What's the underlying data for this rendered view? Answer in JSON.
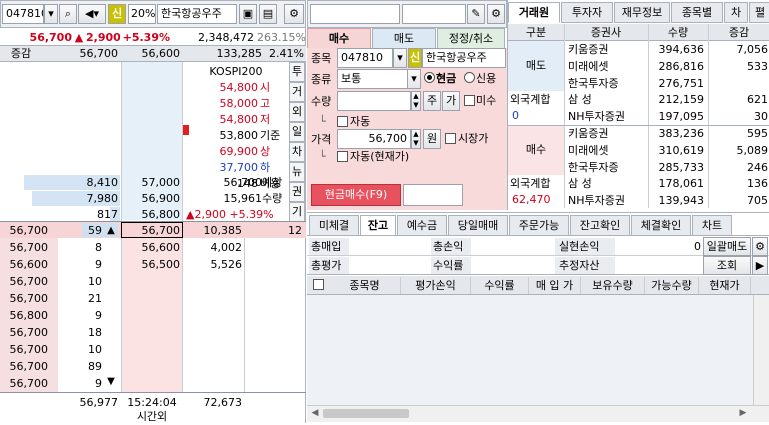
{
  "left": {
    "code": "047810",
    "sin": "신",
    "pct20": "20%",
    "name": "한국항공우주",
    "price": "56,700",
    "arrow": "▲",
    "change": "2,900",
    "rate": "+5.39%",
    "volume": "2,348,472",
    "vrate": "263.15%",
    "hdr_inc": "증감",
    "hdr_p1": "56,700",
    "hdr_p2": "56,600",
    "hdr_amt": "133,285",
    "hdr_ratio": "2.41%",
    "info": [
      {
        "v": "KOSPI200",
        "l": "",
        "c": ""
      },
      {
        "v": "54,800",
        "l": "시",
        "c": "red"
      },
      {
        "v": "58,000",
        "l": "고",
        "c": "red"
      },
      {
        "v": "54,800",
        "l": "저",
        "c": "red"
      },
      {
        "v": "53,800",
        "l": "기준",
        "c": ""
      },
      {
        "v": "69,900",
        "l": "상",
        "c": "red"
      },
      {
        "v": "37,700",
        "l": "하",
        "c": "blue"
      },
      {
        "v": "148",
        "l": "비용",
        "c": ""
      }
    ],
    "side_tabs": [
      "투",
      "거",
      "외",
      "일",
      "차",
      "뉴",
      "권",
      "기"
    ],
    "ask_rows": [
      {
        "q": "8,410",
        "p": "57,000"
      },
      {
        "q": "7,980",
        "p": "56,900"
      },
      {
        "q": "817",
        "p": "56,800"
      }
    ],
    "expect": {
      "p": "56,700",
      "l": "예상"
    },
    "qty": {
      "v": "15,961",
      "l": "수량"
    },
    "expect_chg": "▲2,900  +5.39%",
    "bid_row": {
      "t": "56,700",
      "n": "59",
      "p": "56,700",
      "q": "10,385",
      "x": "12"
    },
    "bid_rows": [
      {
        "p": "56,600",
        "q": "4,002"
      },
      {
        "p": "56,500",
        "q": "5,526"
      }
    ],
    "ticks": [
      {
        "p": "56,700",
        "n": "8"
      },
      {
        "p": "56,600",
        "n": "9"
      },
      {
        "p": "56,700",
        "n": "10"
      },
      {
        "p": "56,700",
        "n": "21"
      },
      {
        "p": "56,800",
        "n": "9"
      },
      {
        "p": "56,700",
        "n": "18"
      },
      {
        "p": "56,700",
        "n": "10"
      },
      {
        "p": "56,700",
        "n": "89"
      },
      {
        "p": "56,700",
        "n": "9"
      }
    ],
    "footer": {
      "avg": "56,977",
      "time": "15:24:04",
      "after": "시간외",
      "sum": "72,673"
    }
  },
  "order": {
    "tab_buy": "매수",
    "tab_sell": "매도",
    "tab_mod": "정정/취소",
    "lbl_item": "종목",
    "code": "047810",
    "sin": "신",
    "name": "한국항공우주",
    "lbl_type": "종류",
    "type": "보통",
    "cash": "현금",
    "credit": "신용",
    "lbl_qty": "수량",
    "qty_btn1": "주",
    "qty_btn2": "가",
    "unset": "미수",
    "auto1": "자동",
    "lbl_price": "가격",
    "price": "56,700",
    "won": "원",
    "market": "시장가",
    "auto2": "자동(현재가)",
    "submit": "현금매수(F9)"
  },
  "broker": {
    "tabs": [
      "거래원",
      "투자자",
      "재무정보",
      "종목별",
      "차",
      "펼"
    ],
    "headers": [
      "구분",
      "증권사",
      "수량",
      "증감"
    ],
    "sell_label": "매도",
    "sell": [
      {
        "f": "키움증권",
        "q": "394,636",
        "d": "7,056"
      },
      {
        "f": "미래에셋",
        "q": "286,816",
        "d": "533"
      },
      {
        "f": "한국투자증",
        "q": "276,751",
        "d": ""
      },
      {
        "f": "삼 성",
        "q": "212,159",
        "d": "621"
      },
      {
        "f": "NH투자증권",
        "q": "197,095",
        "d": "30"
      }
    ],
    "foreign1": "외국계합",
    "foreign1_v": "0",
    "buy_label": "매수",
    "buy": [
      {
        "f": "키움증권",
        "q": "383,236",
        "d": "595"
      },
      {
        "f": "미래에셋",
        "q": "310,619",
        "d": "5,089"
      },
      {
        "f": "한국투자증",
        "q": "285,733",
        "d": "246"
      },
      {
        "f": "삼 성",
        "q": "178,061",
        "d": "136"
      },
      {
        "f": "NH투자증권",
        "q": "139,943",
        "d": "705"
      }
    ],
    "foreign2": "외국계합",
    "foreign2_v": "62,470"
  },
  "balance": {
    "tabs": [
      "미체결",
      "잔고",
      "예수금",
      "당일매매",
      "주문가능",
      "잔고확인",
      "체결확인",
      "차트"
    ],
    "r1": [
      "총매입",
      "총손익",
      "실현손익",
      "0",
      "일괄매도"
    ],
    "r2": [
      "총평가",
      "수익률",
      "추정자산",
      "조회"
    ],
    "cols": [
      "종목명",
      "평가손익",
      "수익률",
      "매 입 가",
      "보유수량",
      "가능수량",
      "현재가"
    ]
  }
}
